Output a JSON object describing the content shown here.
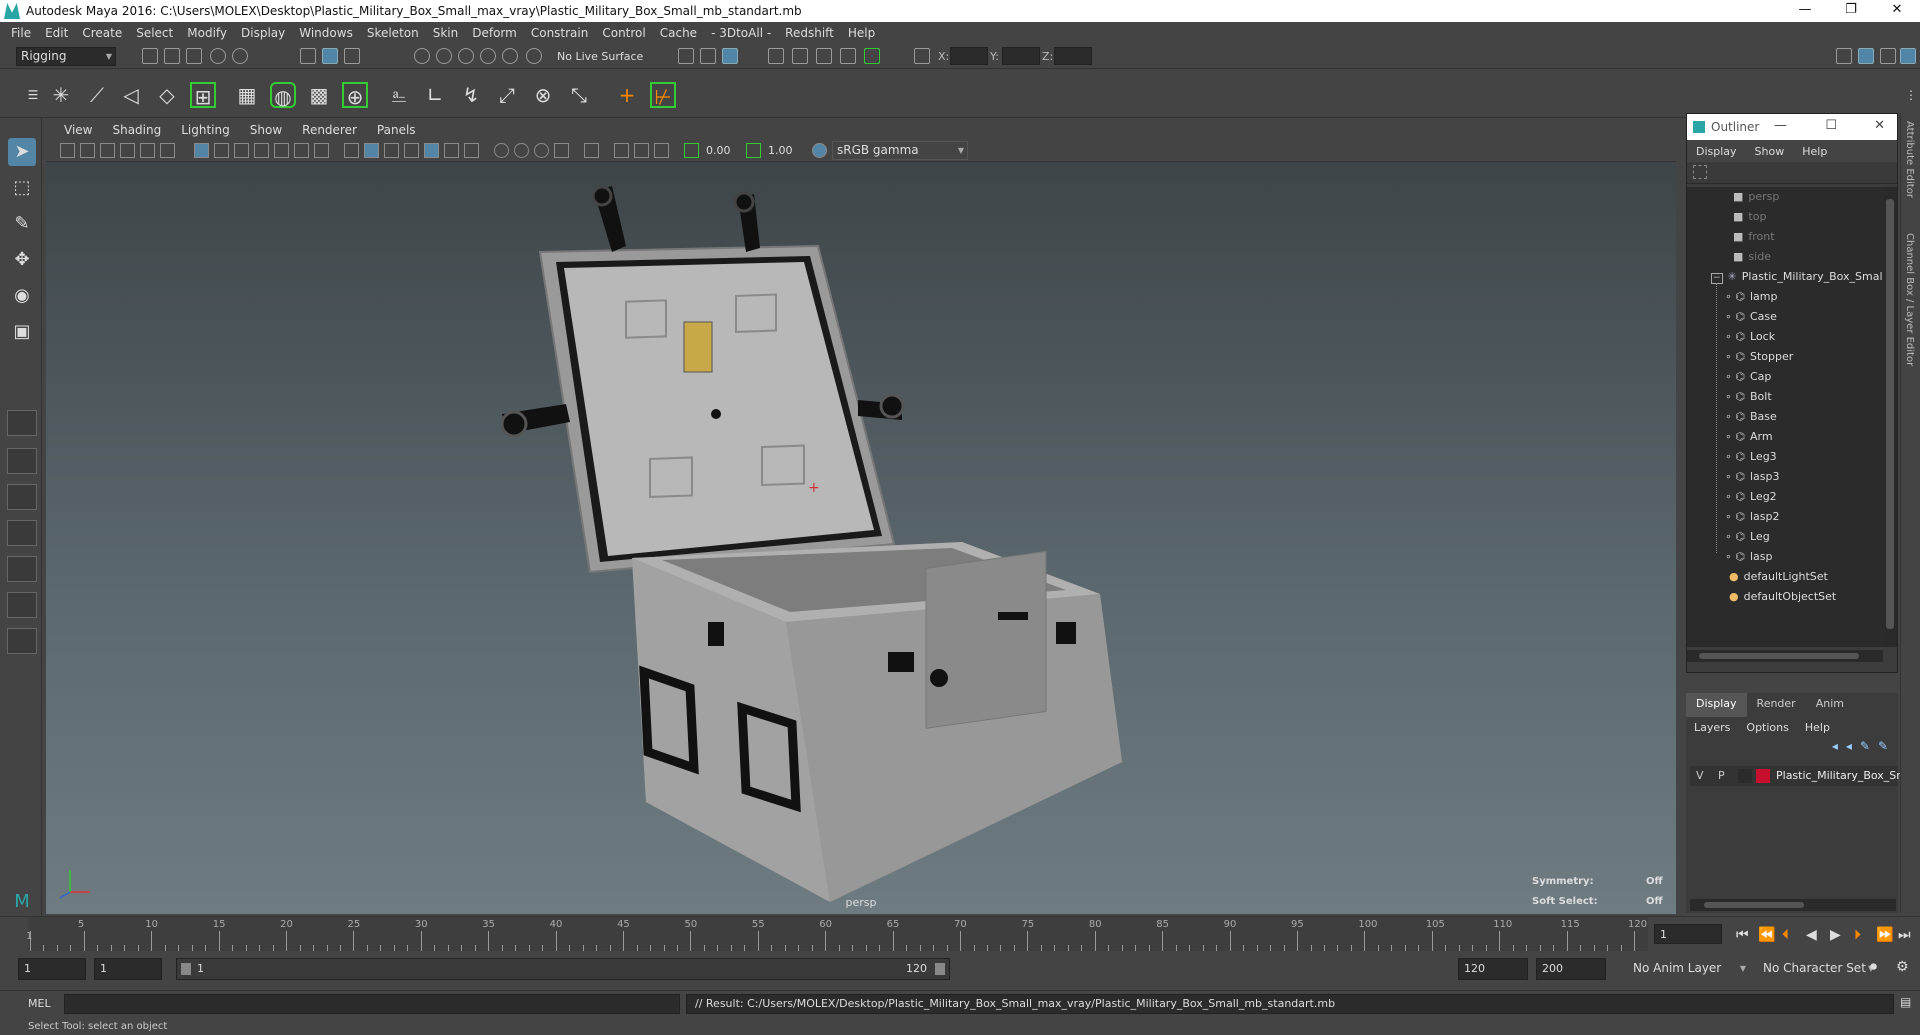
{
  "window": {
    "title": "Autodesk Maya 2016: C:\\Users\\MOLEX\\Desktop\\Plastic_Military_Box_Small_max_vray\\Plastic_Military_Box_Small_mb_standart.mb",
    "minimize": "—",
    "restore": "❐",
    "close": "✕"
  },
  "menubar": [
    "File",
    "Edit",
    "Create",
    "Select",
    "Modify",
    "Display",
    "Windows",
    "Skeleton",
    "Skin",
    "Deform",
    "Constrain",
    "Control",
    "Cache",
    "- 3DtoAll -",
    "Redshift",
    "Help"
  ],
  "statusline": {
    "menu_set": "Rigging",
    "live_surface": "No Live Surface",
    "x_label": "X:",
    "y_label": "Y:",
    "z_label": "Z:"
  },
  "viewport": {
    "menus": [
      "View",
      "Shading",
      "Lighting",
      "Show",
      "Renderer",
      "Panels"
    ],
    "near_value": "0.00",
    "far_value": "1.00",
    "color_space": "sRGB gamma",
    "camera_label": "persp",
    "symmetry_label": "Symmetry:",
    "symmetry_value": "Off",
    "soft_select_label": "Soft Select:",
    "soft_select_value": "Off"
  },
  "outliner": {
    "title": "Outliner",
    "menus": [
      "Display",
      "Show",
      "Help"
    ],
    "cameras": [
      "persp",
      "top",
      "front",
      "side"
    ],
    "group": "Plastic_Military_Box_Small_",
    "children": [
      "lamp",
      "Case",
      "Lock",
      "Stopper",
      "Cap",
      "Bolt",
      "Base",
      "Arm",
      "Leg3",
      "lasp3",
      "Leg2",
      "lasp2",
      "Leg",
      "lasp"
    ],
    "sets": [
      "defaultLightSet",
      "defaultObjectSet"
    ]
  },
  "layers": {
    "tabs": [
      "Display",
      "Render",
      "Anim"
    ],
    "menus": [
      "Layers",
      "Options",
      "Help"
    ],
    "layer_v": "V",
    "layer_p": "P",
    "layer_name": "Plastic_Military_Box_Sm",
    "layer_color": "#c8102e"
  },
  "side_tabs": [
    "Attribute Editor",
    "Channel Box / Layer Editor"
  ],
  "timeslider": {
    "ticks": [
      "5",
      "10",
      "15",
      "20",
      "25",
      "30",
      "35",
      "40",
      "45",
      "50",
      "55",
      "60",
      "65",
      "70",
      "75",
      "80",
      "85",
      "90",
      "95",
      "100",
      "105",
      "110",
      "115",
      "120"
    ],
    "start_tick": "1",
    "current_frame": "1"
  },
  "rangeslider": {
    "start": "1",
    "playback_start": "1",
    "range_start": "1",
    "range_end": "120",
    "playback_end": "120",
    "end": "200",
    "anim_layer": "No Anim Layer",
    "character_set": "No Character Set"
  },
  "cmdline": {
    "lang": "MEL",
    "result": "// Result: C:/Users/MOLEX/Desktop/Plastic_Military_Box_Small_max_vray/Plastic_Military_Box_Small_mb_standart.mb"
  },
  "helpline": "Select Tool: select an object",
  "colors": {
    "accent": "#5285a6",
    "maya_teal": "#2aa6a6"
  }
}
